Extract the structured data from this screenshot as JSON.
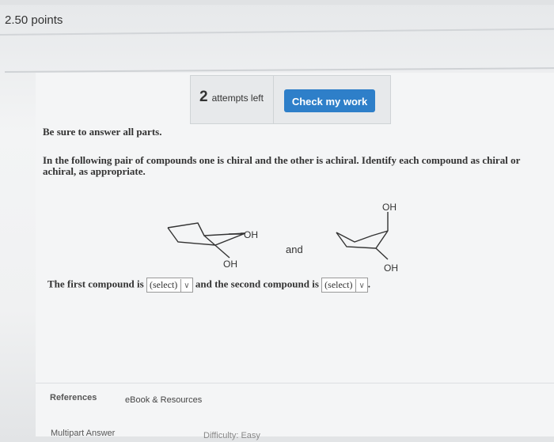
{
  "header": {
    "points": "2.50 points"
  },
  "attempts": {
    "count": "2",
    "label": "attempts left"
  },
  "actions": {
    "check_label": "Check my work"
  },
  "question": {
    "instruction": "Be sure to answer all parts.",
    "prompt": "In the following pair of compounds one is chiral and the other is achiral. Identify each compound as chiral or achiral, as appropriate."
  },
  "structures": {
    "left_oh_top": "OH",
    "left_oh_bottom": "OH",
    "connector": "and",
    "right_oh_top": "OH",
    "right_oh_bottom": "OH"
  },
  "answer": {
    "part1": "The first compound is",
    "select1": "(select)",
    "part2": "and the second compound is",
    "select2": "(select)",
    "end": "."
  },
  "footer": {
    "references": "References",
    "ebook": "eBook & Resources",
    "multipart": "Multipart Answer",
    "difficulty": "Difficulty: Easy"
  }
}
